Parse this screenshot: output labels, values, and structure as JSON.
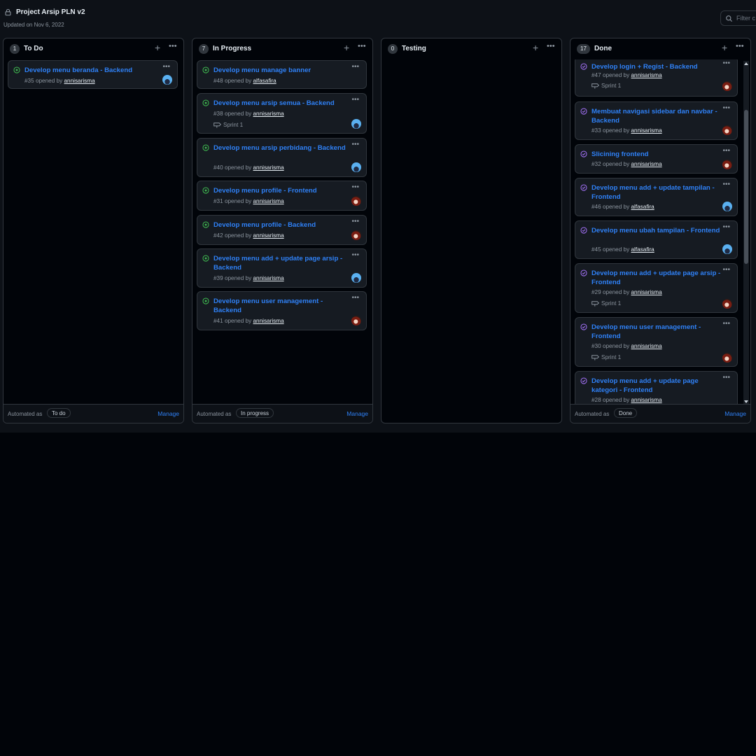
{
  "project": {
    "title": "Project Arsip PLN v2",
    "updated": "Updated on Nov 6, 2022",
    "filter_placeholder": "Filter c"
  },
  "columns": [
    {
      "name": "To Do",
      "count": "1",
      "automated_label": "Automated as",
      "automated_value": "To do",
      "manage": "Manage",
      "cards": [
        {
          "title": "Develop menu beranda - Backend",
          "number": "#35",
          "opened_by": "opened by",
          "user": "annisarisma",
          "avatar": "blue-avatar"
        }
      ]
    },
    {
      "name": "In Progress",
      "count": "7",
      "automated_label": "Automated as",
      "automated_value": "In progress",
      "manage": "Manage",
      "cards": [
        {
          "title": "Develop menu manage banner",
          "number": "#48",
          "opened_by": "opened by",
          "user": "alfasafira"
        },
        {
          "title": "Develop menu arsip semua - Backend",
          "number": "#38",
          "opened_by": "opened by",
          "user": "annisarisma",
          "milestone": "Sprint 1",
          "avatar": "blue-avatar"
        },
        {
          "title": "Develop menu arsip perbidang - Backend",
          "number": "#40",
          "opened_by": "opened by",
          "user": "annisarisma",
          "avatar": "blue-avatar"
        },
        {
          "title": "Develop menu profile - Frontend",
          "number": "#31",
          "opened_by": "opened by",
          "user": "annisarisma",
          "avatar": "red-avatar"
        },
        {
          "title": "Develop menu profile - Backend",
          "number": "#42",
          "opened_by": "opened by",
          "user": "annisarisma",
          "avatar": "red-avatar"
        },
        {
          "title": "Develop menu add + update page arsip - Backend",
          "number": "#39",
          "opened_by": "opened by",
          "user": "annisarisma",
          "avatar": "blue-avatar"
        },
        {
          "title": "Develop menu user management - Backend",
          "number": "#41",
          "opened_by": "opened by",
          "user": "annisarisma",
          "avatar": "red-avatar"
        }
      ]
    },
    {
      "name": "Testing",
      "count": "0",
      "cards": []
    },
    {
      "name": "Done",
      "count": "17",
      "automated_label": "Automated as",
      "automated_value": "Done",
      "manage": "Manage",
      "cards": [
        {
          "title": "Develop login + Regist - Backend",
          "number": "#47",
          "opened_by": "opened by",
          "user": "annisarisma",
          "milestone": "Sprint 1",
          "avatar": "red-avatar"
        },
        {
          "title": "Membuat navigasi sidebar dan navbar - Backend",
          "number": "#33",
          "opened_by": "opened by",
          "user": "annisarisma",
          "avatar": "red-avatar"
        },
        {
          "title": "Slicining frontend",
          "number": "#32",
          "opened_by": "opened by",
          "user": "annisarisma",
          "avatar": "red-avatar"
        },
        {
          "title": "Develop menu add + update tampilan - Frontend",
          "number": "#46",
          "opened_by": "opened by",
          "user": "alfasafira",
          "avatar": "blue-avatar"
        },
        {
          "title": "Develop menu ubah tampilan - Frontend",
          "number": "#45",
          "opened_by": "opened by",
          "user": "alfasafira",
          "avatar": "blue-avatar"
        },
        {
          "title": "Develop menu add + update page arsip - Frontend",
          "number": "#29",
          "opened_by": "opened by",
          "user": "annisarisma",
          "milestone": "Sprint 1",
          "avatar": "red-avatar"
        },
        {
          "title": "Develop menu user management - Frontend",
          "number": "#30",
          "opened_by": "opened by",
          "user": "annisarisma",
          "milestone": "Sprint 1",
          "avatar": "red-avatar"
        },
        {
          "title": "Develop menu add + update page kategori - Frontend",
          "number": "#28",
          "opened_by": "opened by",
          "user": "annisarisma"
        }
      ]
    }
  ],
  "colors": {
    "open_issue": "#3fb950",
    "closed_issue": "#a371f7",
    "link": "#2f81f7"
  }
}
